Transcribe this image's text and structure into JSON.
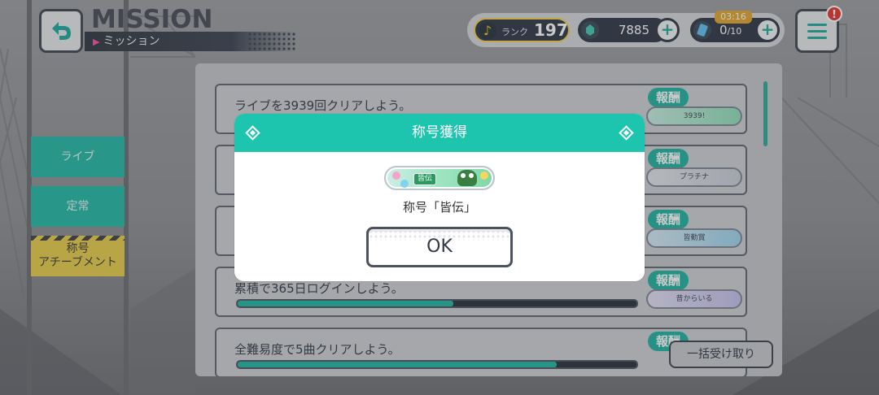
{
  "header": {
    "title_en": "MISSION",
    "title_jp": "ミッション",
    "rank_label": "ランク",
    "rank_value": "197",
    "gems": "7885",
    "energy_value": "0",
    "energy_max": "/10",
    "timer": "03:16",
    "notification": "!"
  },
  "sidebar": {
    "tabs": [
      {
        "label": "ライブ"
      },
      {
        "label": "定常"
      },
      {
        "label": "称号\nアチーブメント"
      }
    ]
  },
  "missions": [
    {
      "text": "ライブを3939回クリアしよう。",
      "reward": "3939!",
      "progress": 0
    },
    {
      "text": "",
      "reward": "プラチナ",
      "progress": 0
    },
    {
      "text": "",
      "reward": "皆勤賞",
      "progress": 0
    },
    {
      "text": "累積で365日ログインしよう。",
      "reward": "昔からいる",
      "progress": 0.54
    },
    {
      "text": "全難易度で5曲クリアしよう。",
      "reward": "",
      "progress": 0.8
    }
  ],
  "reward_tag": "報酬",
  "bulk_button": "一括受け取り",
  "modal": {
    "title": "称号獲得",
    "badge_label": "皆伝",
    "caption": "称号「皆伝」",
    "ok": "OK"
  },
  "colors": {
    "accent": "#1ec5ae",
    "tab": "#21b9a4",
    "title_tab": "#e8cd48",
    "dark": "#2f3744"
  }
}
